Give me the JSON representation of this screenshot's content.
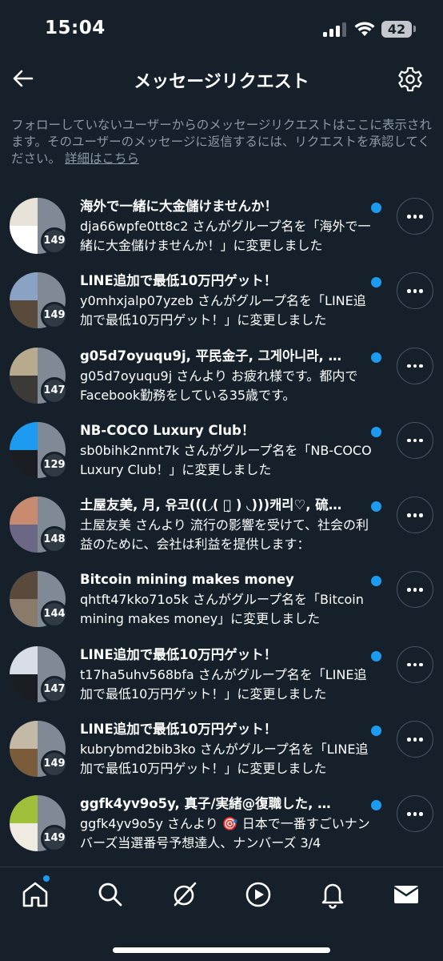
{
  "status_bar": {
    "time": "15:04",
    "battery": "42"
  },
  "header": {
    "title": "メッセージリクエスト"
  },
  "info": {
    "text": "フォローしていないユーザーからのメッセージリクエストはここに表示されます。そのユーザーのメッセージに返信するには、リクエストを承認してください。",
    "link": "詳細はこちら"
  },
  "requests": [
    {
      "title": "海外で一緒に大金儲けませんか！",
      "message": "dja66wpfe0tt8c2 さんがグループ名を「海外で一緒に大金儲けませんか！」に変更しました",
      "count": "149",
      "colors": [
        "#e8e3d8",
        "#ffffff"
      ]
    },
    {
      "title": "LINE追加で最低10万円ゲット！",
      "message": "y0mhxjalp07yzeb さんがグループ名を「LINE追加で最低10万円ゲット！」に変更しました",
      "count": "149",
      "colors": [
        "#8aa3c4",
        "#5a4a3c"
      ]
    },
    {
      "title": "g05d7oyuqu9j, 平民金子, 그게아니라, …",
      "message": "g05d7oyuqu9j さんより お疲れ様です。都内でFacebook勤務をしている35歳です。",
      "count": "147",
      "colors": [
        "#b8ab8d",
        "#3b3a36"
      ]
    },
    {
      "title": "NB-COCO Luxury Club！",
      "message": "sb0bihk2nmt7k さんがグループ名を「NB-COCO Luxury Club！」に変更しました",
      "count": "129",
      "colors": [
        "#1d9bf0",
        "#1a1d22"
      ]
    },
    {
      "title": "土屋友美, 月, 유코(((◞( ＿ͅ ) ◟)))캐리♡, 硫…",
      "message": "土屋友美 さんより 流行の影響を受けて、社会の利益のために、会社は利益を提供します：",
      "count": "148",
      "colors": [
        "#c98b70",
        "#6b6784"
      ]
    },
    {
      "title": "Bitcoin mining makes money",
      "message": "qhtft47kko71o5k さんがグループ名を「Bitcoin mining makes money」に変更しました",
      "count": "144",
      "colors": [
        "#5a4a3c",
        "#8a7a6a"
      ]
    },
    {
      "title": "LINE追加で最低10万円ゲット！",
      "message": "t17ha5uhv568bfa さんがグループ名を「LINE追加で最低10万円ゲット！」に変更しました",
      "count": "147",
      "colors": [
        "#d8dde6",
        "#1a1d22"
      ]
    },
    {
      "title": "LINE追加で最低10万円ゲット！",
      "message": "kubrybmd2bib3ko さんがグループ名を「LINE追加で最低10万円ゲット！」に変更しました",
      "count": "149",
      "colors": [
        "#c4b9a6",
        "#7a5c3a"
      ]
    },
    {
      "title": "ggfk4yv9o5y, 真子/実緒@復職した, …",
      "message": "ggfk4yv9o5y さんより 🎯 日本で一番すごいナンバーズ当選番号予想達人、ナンバーズ 3/4",
      "count": "149",
      "colors": [
        "#9fc03a",
        "#f0ebe0"
      ]
    }
  ],
  "tabs": [
    {
      "name": "home-icon",
      "active": true
    },
    {
      "name": "search-icon"
    },
    {
      "name": "grok-icon"
    },
    {
      "name": "video-icon"
    },
    {
      "name": "notifications-icon"
    },
    {
      "name": "messages-icon"
    }
  ],
  "accent_color": "#1d9bf0"
}
